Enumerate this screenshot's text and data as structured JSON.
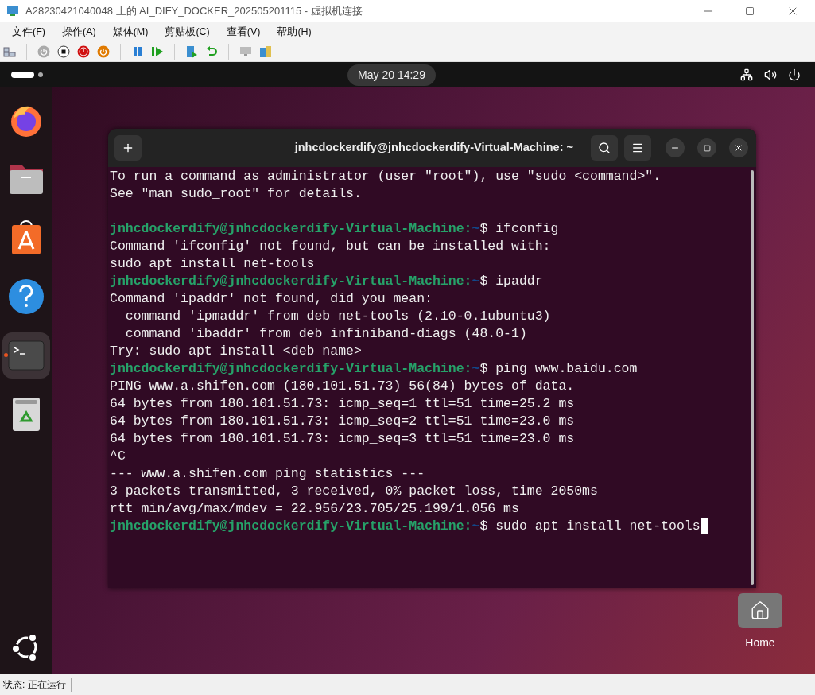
{
  "window": {
    "title": "A28230421040048 上的 AI_DIFY_DOCKER_202505201115 - 虚拟机连接"
  },
  "menu": [
    "文件(F)",
    "操作(A)",
    "媒体(M)",
    "剪贴板(C)",
    "查看(V)",
    "帮助(H)"
  ],
  "toolbar": [
    {
      "kind": "ctrl-alt-del"
    },
    {
      "kind": "sep"
    },
    {
      "kind": "start"
    },
    {
      "kind": "turn-off"
    },
    {
      "kind": "shutdown"
    },
    {
      "kind": "save"
    },
    {
      "kind": "sep"
    },
    {
      "kind": "pause"
    },
    {
      "kind": "resume"
    },
    {
      "kind": "sep"
    },
    {
      "kind": "checkpoint"
    },
    {
      "kind": "revert"
    },
    {
      "kind": "sep"
    },
    {
      "kind": "enhanced"
    },
    {
      "kind": "share"
    }
  ],
  "topbar": {
    "clock": "May 20  14:29"
  },
  "dock": [
    {
      "kind": "firefox",
      "running": false
    },
    {
      "kind": "files",
      "running": false
    },
    {
      "kind": "store",
      "running": false
    },
    {
      "kind": "help",
      "running": false
    },
    {
      "kind": "terminal",
      "running": true
    },
    {
      "kind": "trash",
      "running": false
    }
  ],
  "terminal": {
    "title": "jnhcdockerdify@jnhcdockerdify-Virtual-Machine: ~",
    "lines": [
      {
        "kind": "output",
        "text": "To run a command as administrator (user \"root\"), use \"sudo <command>\"."
      },
      {
        "kind": "output",
        "text": "See \"man sudo_root\" for details."
      },
      {
        "kind": "blank"
      },
      {
        "kind": "prompt",
        "user": "jnhcdockerdify@jnhcdockerdify-Virtual-Machine:",
        "path": "~",
        "command": "$ ifconfig",
        "cursor": false
      },
      {
        "kind": "output",
        "text": "Command 'ifconfig' not found, but can be installed with:"
      },
      {
        "kind": "output",
        "text": "sudo apt install net-tools"
      },
      {
        "kind": "prompt",
        "user": "jnhcdockerdify@jnhcdockerdify-Virtual-Machine:",
        "path": "~",
        "command": "$ ipaddr",
        "cursor": false
      },
      {
        "kind": "output",
        "text": "Command 'ipaddr' not found, did you mean:"
      },
      {
        "kind": "output",
        "text": "  command 'ipmaddr' from deb net-tools (2.10-0.1ubuntu3)"
      },
      {
        "kind": "output",
        "text": "  command 'ibaddr' from deb infiniband-diags (48.0-1)"
      },
      {
        "kind": "output",
        "text": "Try: sudo apt install <deb name>"
      },
      {
        "kind": "prompt",
        "user": "jnhcdockerdify@jnhcdockerdify-Virtual-Machine:",
        "path": "~",
        "command": "$ ping www.baidu.com",
        "cursor": false
      },
      {
        "kind": "output",
        "text": "PING www.a.shifen.com (180.101.51.73) 56(84) bytes of data."
      },
      {
        "kind": "output",
        "text": "64 bytes from 180.101.51.73: icmp_seq=1 ttl=51 time=25.2 ms"
      },
      {
        "kind": "output",
        "text": "64 bytes from 180.101.51.73: icmp_seq=2 ttl=51 time=23.0 ms"
      },
      {
        "kind": "output",
        "text": "64 bytes from 180.101.51.73: icmp_seq=3 ttl=51 time=23.0 ms"
      },
      {
        "kind": "output",
        "text": "^C"
      },
      {
        "kind": "output",
        "text": "--- www.a.shifen.com ping statistics ---"
      },
      {
        "kind": "output",
        "text": "3 packets transmitted, 3 received, 0% packet loss, time 2050ms"
      },
      {
        "kind": "output",
        "text": "rtt min/avg/max/mdev = 22.956/23.705/25.199/1.056 ms"
      },
      {
        "kind": "prompt",
        "user": "jnhcdockerdify@jnhcdockerdify-Virtual-Machine:",
        "path": "~",
        "command": "$ sudo apt install net-tools",
        "cursor": true
      }
    ]
  },
  "desktop_icons": [
    {
      "label": "Home"
    }
  ],
  "status_bar": {
    "text": "状态: 正在运行"
  }
}
